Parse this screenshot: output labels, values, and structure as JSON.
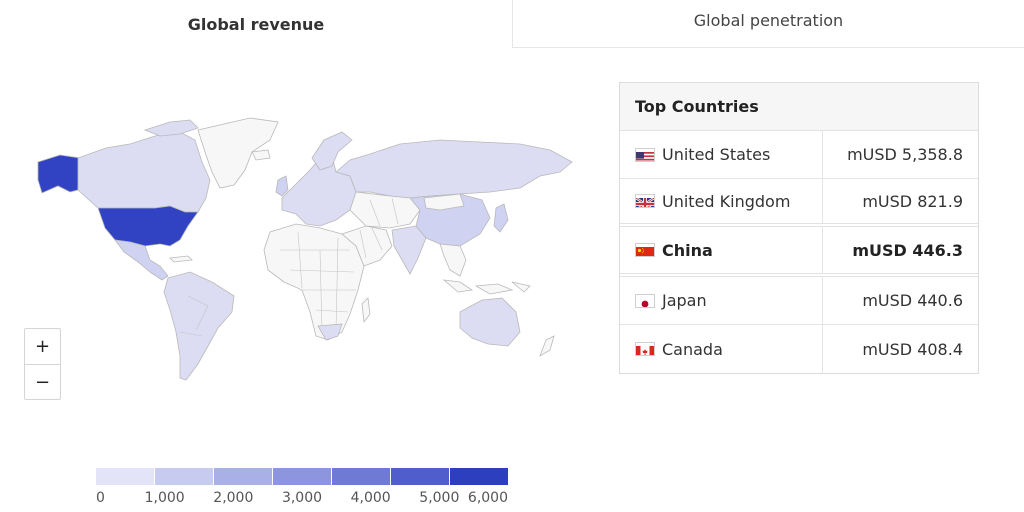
{
  "tabs": [
    {
      "label": "Global revenue"
    },
    {
      "label": "Global penetration"
    }
  ],
  "zoom": {
    "in_label": "+",
    "out_label": "−"
  },
  "table": {
    "header": "Top Countries",
    "rows": [
      {
        "country": "United States",
        "value": "mUSD 5,358.8",
        "flag_icon": "us-flag-icon"
      },
      {
        "country": "United Kingdom",
        "value": "mUSD 821.9",
        "flag_icon": "uk-flag-icon"
      },
      {
        "country": "China",
        "value": "mUSD 446.3",
        "flag_icon": "china-flag-icon"
      },
      {
        "country": "Japan",
        "value": "mUSD 440.6",
        "flag_icon": "japan-flag-icon"
      },
      {
        "country": "Canada",
        "value": "mUSD 408.4",
        "flag_icon": "canada-flag-icon"
      }
    ]
  },
  "legend": {
    "ticks": [
      "0",
      "1,000",
      "2,000",
      "3,000",
      "4,000",
      "5,000",
      "6,000"
    ],
    "colors": [
      "#e3e4f7",
      "#c7cbef",
      "#a9b0e6",
      "#8c95dd",
      "#6e7ad4",
      "#4f5ecb",
      "#2c3fbf"
    ]
  },
  "colors": {
    "highlight": "#3143c2",
    "low": "#dcdcf3",
    "none": "#f7f7f7"
  }
}
